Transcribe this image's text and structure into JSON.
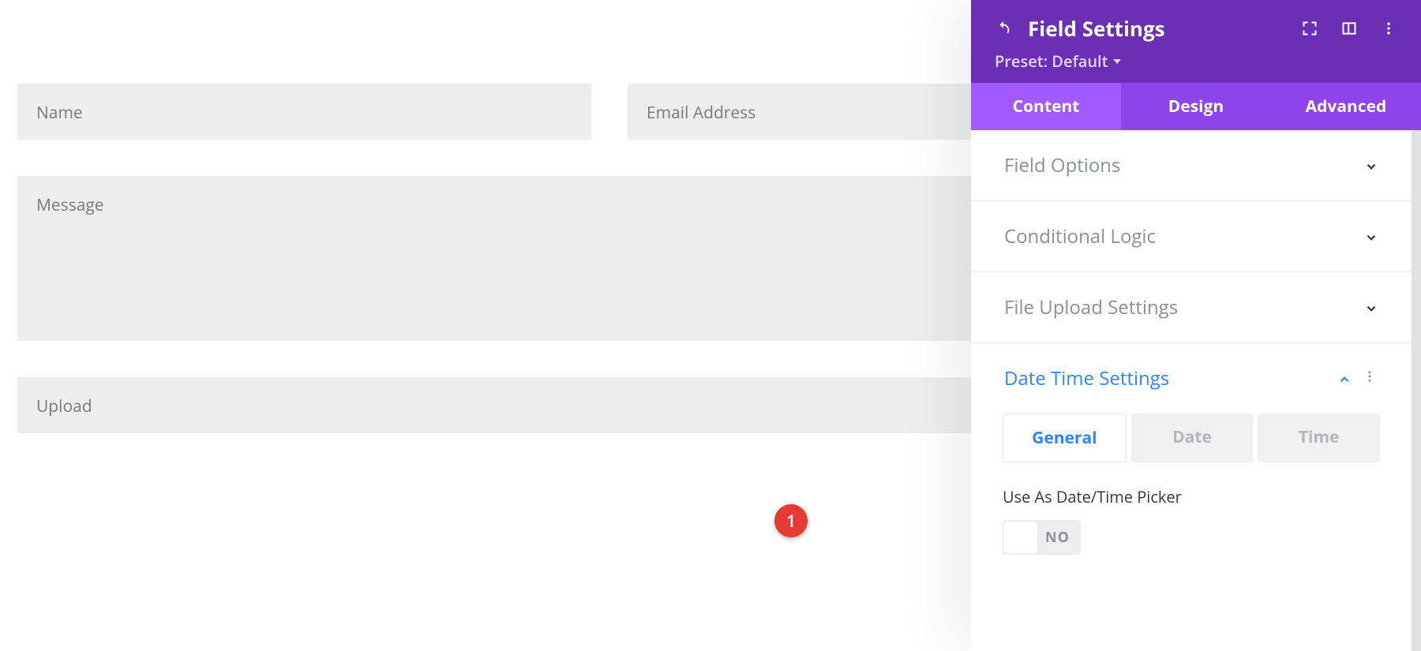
{
  "form": {
    "name_placeholder": "Name",
    "email_placeholder": "Email Address",
    "message_placeholder": "Message",
    "upload_placeholder": "Upload"
  },
  "panel": {
    "title": "Field Settings",
    "preset_label": "Preset: Default",
    "tabs": {
      "content": "Content",
      "design": "Design",
      "advanced": "Advanced"
    },
    "sections": {
      "field_options": "Field Options",
      "conditional_logic": "Conditional Logic",
      "file_upload": "File Upload Settings",
      "date_time": "Date Time Settings"
    },
    "datetime": {
      "subtabs": {
        "general": "General",
        "date": "Date",
        "time": "Time"
      },
      "option_label": "Use As Date/Time Picker",
      "toggle_value": "NO"
    }
  },
  "annotations": {
    "one": "1"
  },
  "icons": {
    "undo": "undo-icon",
    "expand": "expand-icon",
    "panel_toggle": "panel-toggle-icon",
    "more": "more-vertical-icon"
  },
  "colors": {
    "header_bg": "#6b2fb5",
    "tabs_bg": "#8e44ec",
    "tab_active": "#a259ff",
    "accent_blue": "#2d86ff",
    "field_bg": "#eceded",
    "badge_red": "#e53935"
  }
}
